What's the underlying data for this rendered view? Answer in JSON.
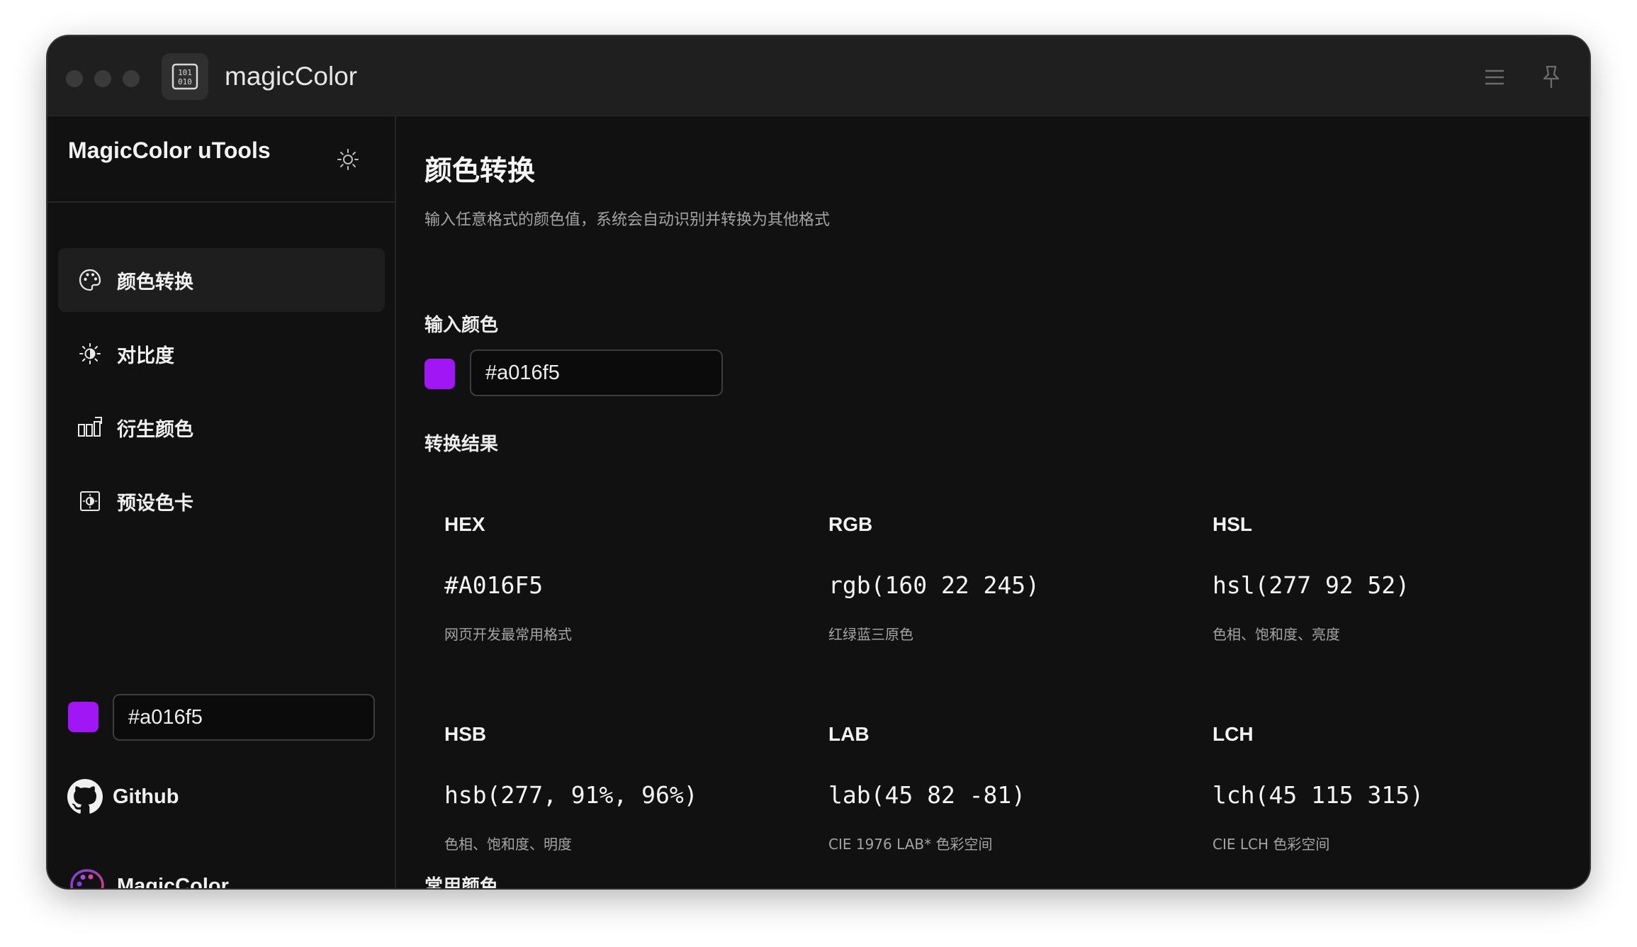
{
  "window": {
    "app_title": "magicColor",
    "icons": {
      "app": "binary-grid-icon",
      "menu": "hamburger-menu-icon",
      "pin": "pin-icon"
    }
  },
  "sidebar": {
    "title": "MagicColor uTools",
    "theme_icon": "sun-icon",
    "nav": [
      {
        "label": "颜色转换",
        "icon": "palette-icon",
        "active": true
      },
      {
        "label": "对比度",
        "icon": "contrast-sun-icon",
        "active": false
      },
      {
        "label": "衍生颜色",
        "icon": "derive-blocks-icon",
        "active": false
      },
      {
        "label": "预设色卡",
        "icon": "preset-card-icon",
        "active": false
      }
    ],
    "color_input": {
      "value": "#a016f5",
      "swatch_color": "#a016f5"
    },
    "links": [
      {
        "label": "Github",
        "icon": "github-icon"
      },
      {
        "label": "MagicColor",
        "icon": "magiccolor-logo-icon"
      }
    ]
  },
  "main": {
    "title": "颜色转换",
    "description": "输入任意格式的颜色值，系统会自动识别并转换为其他格式",
    "input_label": "输入颜色",
    "input": {
      "value": "#a016f5",
      "swatch_color": "#a016f5"
    },
    "results_label": "转换结果",
    "results": [
      {
        "format": "HEX",
        "value": "#A016F5",
        "desc": "网页开发最常用格式"
      },
      {
        "format": "RGB",
        "value": "rgb(160 22 245)",
        "desc": "红绿蓝三原色"
      },
      {
        "format": "HSL",
        "value": "hsl(277 92 52)",
        "desc": "色相、饱和度、亮度"
      },
      {
        "format": "HSB",
        "value": "hsb(277, 91%, 96%)",
        "desc": "色相、饱和度、明度"
      },
      {
        "format": "LAB",
        "value": "lab(45 82 -81)",
        "desc": "CIE 1976 LAB* 色彩空间"
      },
      {
        "format": "LCH",
        "value": "lch(45 115 315)",
        "desc": "CIE LCH 色彩空间"
      }
    ],
    "next_section_label": "常用颜色"
  },
  "colors": {
    "accent": "#a016f5",
    "background": "#111111",
    "titlebar": "#1f1f1f",
    "active_nav": "#1e1e1e"
  }
}
